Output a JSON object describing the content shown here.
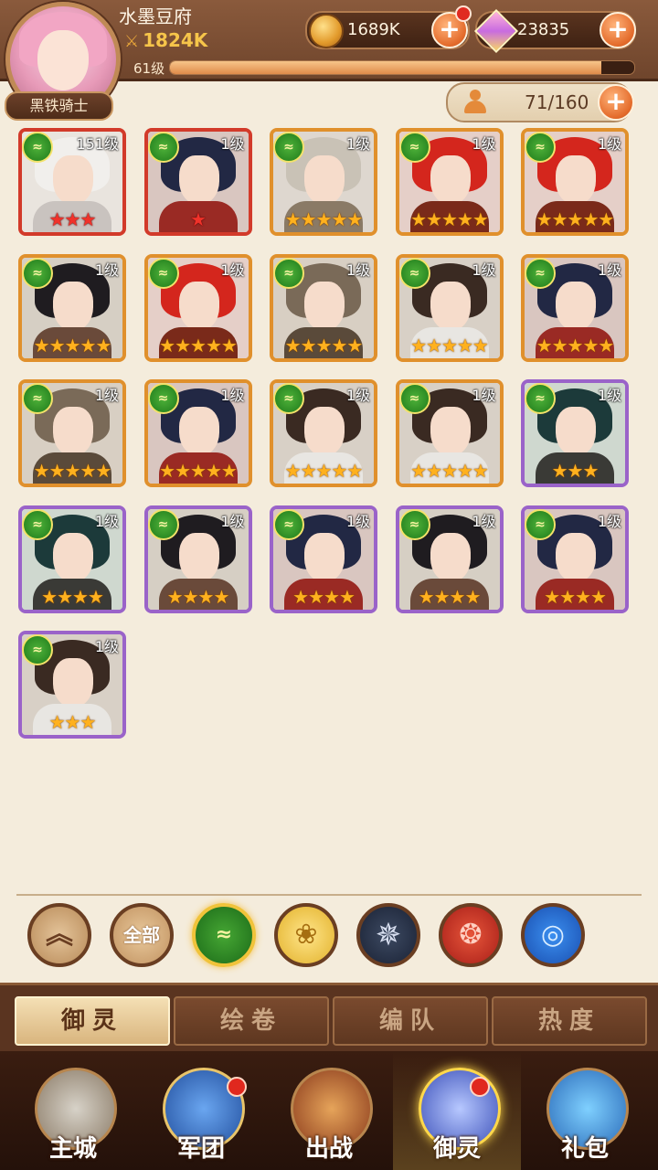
{
  "player": {
    "name": "水墨豆府",
    "power": "1824K",
    "level": "61级",
    "xp_fraction": 0.93,
    "title": "黑铁骑士"
  },
  "resources": {
    "coins": "1689K",
    "gems": "23835"
  },
  "roster_capacity": "71/160",
  "heroes": [
    {
      "level": "151级",
      "stars": 3,
      "star_color": "red",
      "quality": "red",
      "theme": "white"
    },
    {
      "level": "1级",
      "stars": 1,
      "star_color": "red",
      "quality": "red",
      "theme": "navy"
    },
    {
      "level": "1级",
      "stars": 5,
      "star_color": "gold",
      "quality": "orange",
      "theme": "silver"
    },
    {
      "level": "1级",
      "stars": 5,
      "star_color": "gold",
      "quality": "orange",
      "theme": "crimson"
    },
    {
      "level": "1级",
      "stars": 5,
      "star_color": "gold",
      "quality": "orange",
      "theme": "crimson"
    },
    {
      "level": "1级",
      "stars": 5,
      "star_color": "gold",
      "quality": "orange",
      "theme": "black"
    },
    {
      "level": "1级",
      "stars": 5,
      "star_color": "gold",
      "quality": "orange",
      "theme": "crimson"
    },
    {
      "level": "1级",
      "stars": 5,
      "star_color": "gold",
      "quality": "orange",
      "theme": "brown"
    },
    {
      "level": "1级",
      "stars": 5,
      "star_color": "gold",
      "quality": "orange",
      "theme": "dark"
    },
    {
      "level": "1级",
      "stars": 5,
      "star_color": "gold",
      "quality": "orange",
      "theme": "navy"
    },
    {
      "level": "1级",
      "stars": 5,
      "star_color": "gold",
      "quality": "orange",
      "theme": "brown"
    },
    {
      "level": "1级",
      "stars": 5,
      "star_color": "gold",
      "quality": "orange",
      "theme": "navy"
    },
    {
      "level": "1级",
      "stars": 5,
      "star_color": "gold",
      "quality": "orange",
      "theme": "dark"
    },
    {
      "level": "1级",
      "stars": 5,
      "star_color": "gold",
      "quality": "orange",
      "theme": "dark"
    },
    {
      "level": "1级",
      "stars": 3,
      "star_color": "gold",
      "quality": "purple",
      "theme": "teal"
    },
    {
      "level": "1级",
      "stars": 4,
      "star_color": "gold",
      "quality": "purple",
      "theme": "teal"
    },
    {
      "level": "1级",
      "stars": 4,
      "star_color": "gold",
      "quality": "purple",
      "theme": "black"
    },
    {
      "level": "1级",
      "stars": 4,
      "star_color": "gold",
      "quality": "purple",
      "theme": "navy"
    },
    {
      "level": "1级",
      "stars": 4,
      "star_color": "gold",
      "quality": "purple",
      "theme": "black"
    },
    {
      "level": "1级",
      "stars": 4,
      "star_color": "gold",
      "quality": "purple",
      "theme": "navy"
    },
    {
      "level": "1级",
      "stars": 3,
      "star_color": "gold",
      "quality": "purple",
      "theme": "dark"
    }
  ],
  "filters": [
    {
      "name": "collapse-filter-button",
      "icon": "chevron-up-icon",
      "glyph": "︽"
    },
    {
      "name": "filter-all-button",
      "icon": "all-text",
      "glyph": "全部"
    },
    {
      "name": "filter-nature-button",
      "icon": "leaf-faction-icon",
      "glyph": "≈"
    },
    {
      "name": "filter-light-button",
      "icon": "rose-faction-icon",
      "glyph": "❀"
    },
    {
      "name": "filter-dark-button",
      "icon": "star-faction-icon",
      "glyph": "✵"
    },
    {
      "name": "filter-fire-button",
      "icon": "phoenix-faction-icon",
      "glyph": "❂"
    },
    {
      "name": "filter-water-button",
      "icon": "wave-faction-icon",
      "glyph": "◎"
    }
  ],
  "tabs": [
    "御灵",
    "绘卷",
    "编队",
    "热度"
  ],
  "nav": [
    {
      "label": "主城",
      "icon": "castle-icon",
      "badge": false
    },
    {
      "label": "军团",
      "icon": "legion-shield-icon",
      "badge": true
    },
    {
      "label": "出战",
      "icon": "battle-gate-icon",
      "badge": false
    },
    {
      "label": "御灵",
      "icon": "crystal-spirit-icon",
      "badge": true
    },
    {
      "label": "礼包",
      "icon": "gift-shop-icon",
      "badge": false
    }
  ]
}
